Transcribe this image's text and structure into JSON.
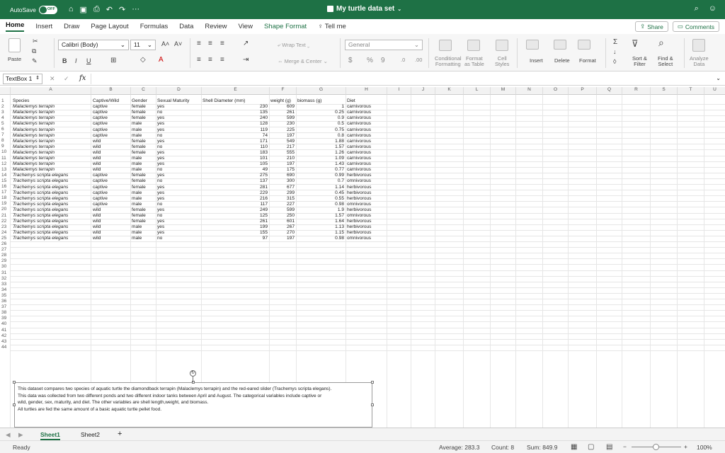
{
  "titlebar": {
    "autosave_label": "AutoSave",
    "autosave_state": "OFF",
    "doc_title": "My turtle data set",
    "accent": "#1e7145"
  },
  "tabs": [
    "Home",
    "Insert",
    "Draw",
    "Page Layout",
    "Formulas",
    "Data",
    "Review",
    "View",
    "Shape Format",
    "Tell me"
  ],
  "tab_buttons": {
    "share": "Share",
    "comments": "Comments"
  },
  "ribbon": {
    "paste": "Paste",
    "font_name": "Calibri (Body)",
    "font_size": "11",
    "bold": "B",
    "italic": "I",
    "underline": "U",
    "wrap_text": "Wrap Text",
    "merge_center": "Merge & Center",
    "number_format": "General",
    "currency": "$",
    "percent": "%",
    "comma": "9",
    "conditional_formatting": [
      "Conditional",
      "Formatting"
    ],
    "format_as_table": [
      "Format",
      "as Table"
    ],
    "cell_styles": [
      "Cell",
      "Styles"
    ],
    "insert": "Insert",
    "delete": "Delete",
    "format": "Format",
    "sort_filter": [
      "Sort &",
      "Filter"
    ],
    "find_select": [
      "Find &",
      "Select"
    ],
    "analyze_data": [
      "Analyze",
      "Data"
    ]
  },
  "formula_bar": {
    "name_box": "TextBox 1",
    "fx": "fx",
    "cancel": "✕",
    "confirm": "✓",
    "content": ""
  },
  "columns": [
    "A",
    "B",
    "C",
    "D",
    "E",
    "F",
    "G",
    "H",
    "I",
    "J",
    "K",
    "L",
    "M",
    "N",
    "O",
    "P",
    "Q",
    "R",
    "S",
    "T",
    "U"
  ],
  "headers": [
    "Species",
    "Captive/Wild",
    "Gender",
    "Sexual Maturity",
    "Shell Diameter (mm)",
    "weight (g)",
    "biomass (g)",
    "Diet"
  ],
  "rows": [
    [
      "Malaclemys terrapin",
      "captive",
      "female",
      "yes",
      "230",
      "609",
      "1",
      "carnivorous"
    ],
    [
      "Malaclemys terrapin",
      "captive",
      "female",
      "no",
      "135",
      "261",
      "0.25",
      "carnivorous"
    ],
    [
      "Malaclemys terrapin",
      "captive",
      "female",
      "yes",
      "240",
      "599",
      "0.9",
      "carnivorous"
    ],
    [
      "Malaclemys terrapin",
      "captive",
      "male",
      "yes",
      "128",
      "230",
      "0.5",
      "carnivorous"
    ],
    [
      "Malaclemys terrapin",
      "captive",
      "male",
      "yes",
      "119",
      "225",
      "0.75",
      "carnivorous"
    ],
    [
      "Malaclemys terrapin",
      "captive",
      "male",
      "no",
      "74",
      "197",
      "0.8",
      "carnivorous"
    ],
    [
      "Malaclemys terrapin",
      "wild",
      "female",
      "yes",
      "171",
      "549",
      "1.88",
      "carnivorous"
    ],
    [
      "Malaclemys terrapin",
      "wild",
      "female",
      "no",
      "110",
      "217",
      "1.57",
      "carnivorous"
    ],
    [
      "Malaclemys terrapin",
      "wild",
      "female",
      "yes",
      "183",
      "555",
      "1.26",
      "carnivorous"
    ],
    [
      "Malaclemys terrapin",
      "wild",
      "male",
      "yes",
      "101",
      "210",
      "1.09",
      "carnivorous"
    ],
    [
      "Malaclemys terrapin",
      "wild",
      "male",
      "yes",
      "105",
      "197",
      "1.43",
      "carnivorous"
    ],
    [
      "Malaclemys terrapin",
      "wild",
      "male",
      "no",
      "49",
      "175",
      "0.77",
      "carnivorous"
    ],
    [
      "Trachemys scripta elegans",
      "captive",
      "female",
      "yes",
      "275",
      "690",
      "0.99",
      "herbivorous"
    ],
    [
      "Trachemys scripta elegans",
      "captive",
      "female",
      "no",
      "137",
      "300",
      "0.7",
      "omnivorous"
    ],
    [
      "Trachemys scripta elegans",
      "captive",
      "female",
      "yes",
      "281",
      "677",
      "1.14",
      "herbivorous"
    ],
    [
      "Trachemys scripta elegans",
      "captive",
      "male",
      "yes",
      "229",
      "299",
      "0.45",
      "herbivorous"
    ],
    [
      "Trachemys scripta elegans",
      "captive",
      "male",
      "yes",
      "216",
      "315",
      "0.55",
      "herbivorous"
    ],
    [
      "Trachemys scripta elegans",
      "captive",
      "male",
      "no",
      "117",
      "227",
      "0.98",
      "omnivorous"
    ],
    [
      "Trachemys scripta elegans",
      "wild",
      "female",
      "yes",
      "249",
      "599",
      "1.9",
      "herbivorous"
    ],
    [
      "Trachemys scripta elegans",
      "wild",
      "female",
      "no",
      "125",
      "250",
      "1.57",
      "omnivorous"
    ],
    [
      "Trachemys scripta elegans",
      "wild",
      "female",
      "yes",
      "261",
      "601",
      "1.64",
      "herbivorous"
    ],
    [
      "Trachemys scripta elegans",
      "wild",
      "male",
      "yes",
      "199",
      "267",
      "1.13",
      "herbivorous"
    ],
    [
      "Trachemys scripta elegans",
      "wild",
      "male",
      "yes",
      "155",
      "270",
      "1.15",
      "herbivorous"
    ],
    [
      "Trachemys scripta elegans",
      "wild",
      "male",
      "no",
      "97",
      "197",
      "0.98",
      "omnivorous"
    ]
  ],
  "row_numbers": [
    "1",
    "2",
    "3",
    "4",
    "5",
    "6",
    "7",
    "8",
    "9",
    "10",
    "11",
    "12",
    "13",
    "14",
    "15",
    "16",
    "17",
    "18",
    "19",
    "20",
    "21",
    "22",
    "23",
    "24",
    "25",
    "26",
    "27",
    "28",
    "29",
    "30",
    "31",
    "32",
    "33",
    "34",
    "35",
    "36",
    "37",
    "38",
    "39",
    "40",
    "41",
    "42",
    "43",
    "44"
  ],
  "textbox": {
    "lines": [
      "This dataset compares two species of aquatic turtle the diamondback terrapin (Malaclemys terrapin) and the red-eared slider (Trachemys scripta elegans).",
      "This data was collected from two different ponds and two different indoor tanks between April and August. The categorical variables include captive or",
      "wild, gender, sex, maturity, and diet. The other variables are shell length,weight, and biomass.",
      "All turtles are fed the same amount of a basic aquatic turtle pellet food."
    ]
  },
  "sheets": [
    "Sheet1",
    "Sheet2"
  ],
  "add_sheet": "+",
  "status": {
    "ready": "Ready",
    "average": "Average: 283.3",
    "count": "Count: 8",
    "sum": "Sum: 849.9",
    "zoom": "100%"
  }
}
